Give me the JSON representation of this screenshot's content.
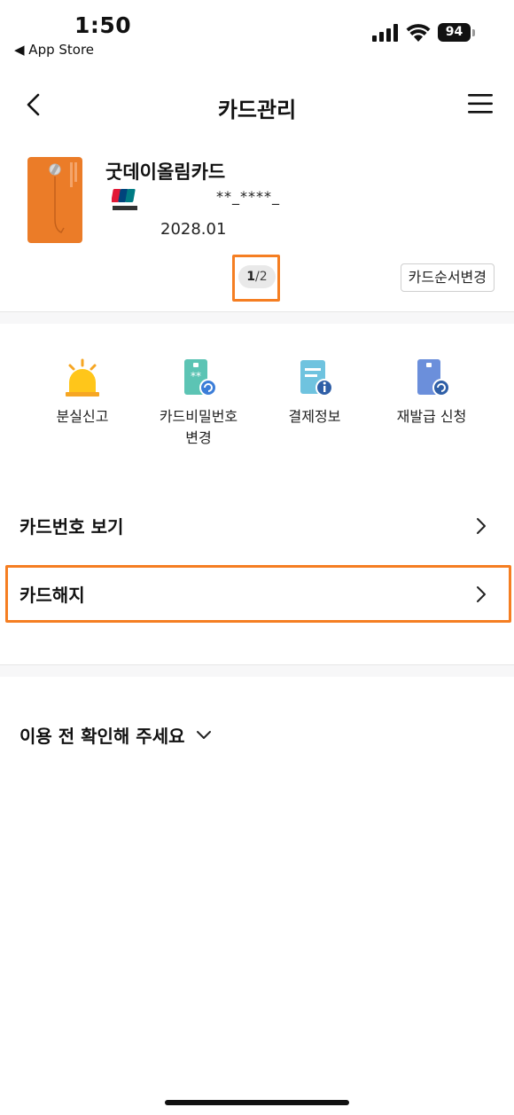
{
  "status_bar": {
    "time": "1:50",
    "back_app": "◀ App Store",
    "battery": "94"
  },
  "nav": {
    "title": "카드관리",
    "back_icon": "chevron-left-icon",
    "menu_icon": "hamburger-menu-icon"
  },
  "card": {
    "name": "굿데이올림카드",
    "number": "**_****_",
    "expiry": "2028.01",
    "color": "#eb7c28"
  },
  "pager": {
    "current": "1",
    "total": "2"
  },
  "order_button": "카드순서변경",
  "quick_menu": [
    {
      "label": "분실신고",
      "icon": "alarm-siren-icon"
    },
    {
      "label": "카드비밀번호\n변경",
      "icon": "card-pin-change-icon"
    },
    {
      "label": "결제정보",
      "icon": "payment-info-icon"
    },
    {
      "label": "재발급 신청",
      "icon": "card-reissue-icon"
    }
  ],
  "list": {
    "card_number_view": "카드번호 보기",
    "card_cancel": "카드해지"
  },
  "notice": {
    "label": "이용 전 확인해 주세요"
  },
  "colors": {
    "highlight": "#f57e22",
    "accent_teal": "#5cc4b4",
    "accent_blue": "#3b7dd8"
  }
}
